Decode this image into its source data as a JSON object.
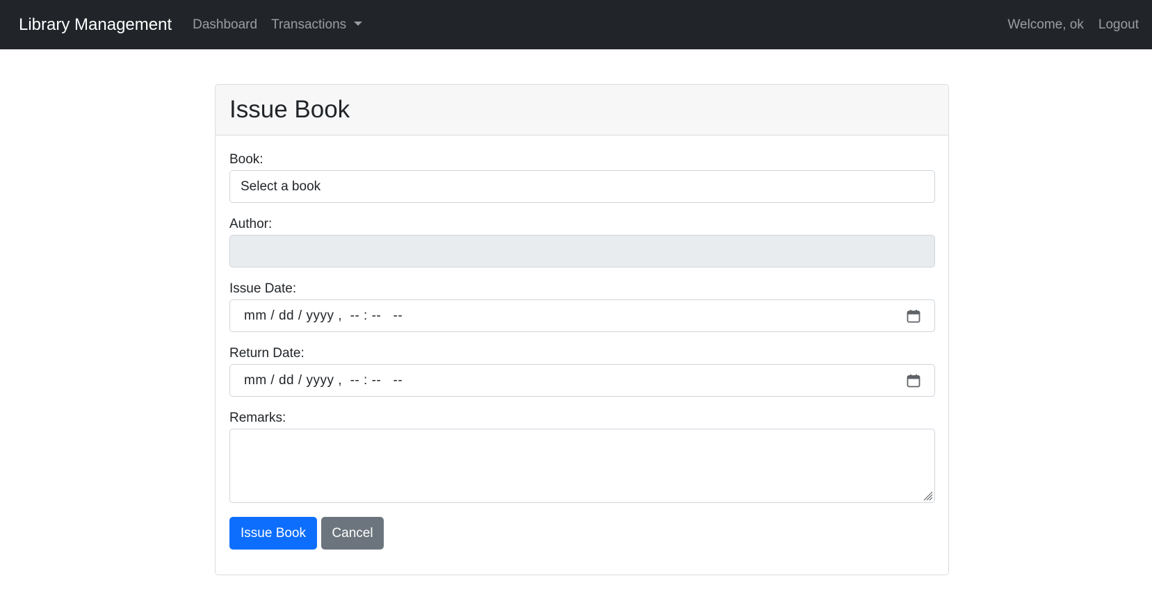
{
  "navbar": {
    "brand": "Library Management",
    "links": {
      "dashboard": "Dashboard",
      "transactions": "Transactions"
    },
    "welcome": "Welcome, ok",
    "logout": "Logout"
  },
  "card": {
    "title": "Issue Book",
    "fields": {
      "book": {
        "label": "Book:",
        "value": "Select a book"
      },
      "author": {
        "label": "Author:",
        "value": ""
      },
      "issue_date": {
        "label": "Issue Date:",
        "placeholder": "mm / dd / yyyy ,  -- : --   --",
        "icon": "calendar-icon"
      },
      "return_date": {
        "label": "Return Date:",
        "placeholder": "mm / dd / yyyy ,  -- : --   --",
        "icon": "calendar-icon"
      },
      "remarks": {
        "label": "Remarks:",
        "value": ""
      }
    },
    "buttons": {
      "issue": "Issue Book",
      "cancel": "Cancel"
    }
  },
  "colors": {
    "navbar_bg": "#212529",
    "primary": "#0d6efd",
    "secondary": "#6c757d",
    "disabled_input": "#e9ecef"
  }
}
